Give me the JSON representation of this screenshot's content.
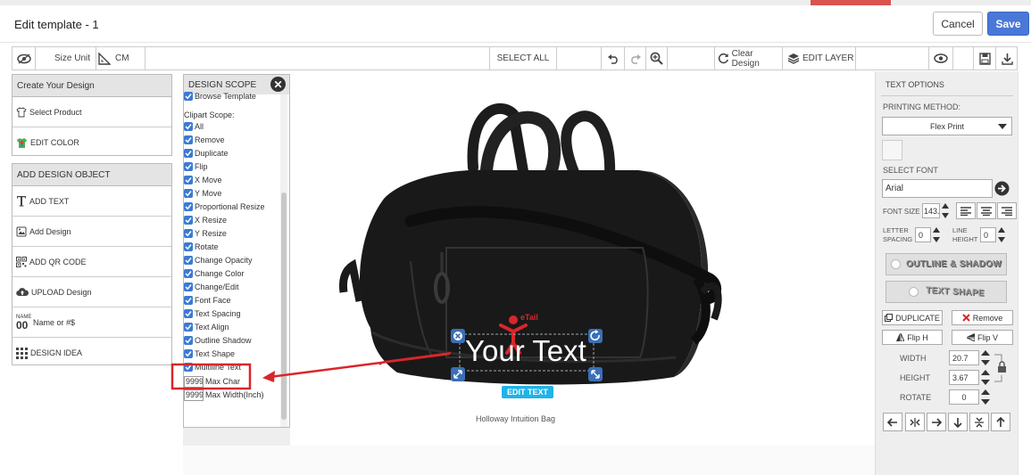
{
  "window": {
    "title": "Edit template - 1",
    "cancel_label": "Cancel",
    "save_label": "Save"
  },
  "toolbar": {
    "size_unit_label": "Size Unit",
    "unit_value": "CM",
    "select_all": "SELECT ALL",
    "clear_design": "Clear Design",
    "edit_layer": "EDIT LAYER"
  },
  "left_panel": {
    "create_header": "Create Your Design",
    "create_items": [
      "Select Product",
      "EDIT COLOR"
    ],
    "add_header": "ADD DESIGN OBJECT",
    "add_items": [
      "ADD TEXT",
      "Add Design",
      "ADD QR CODE",
      "UPLOAD Design",
      "Name or #$",
      "DESIGN IDEA"
    ],
    "name_icon_text": "00",
    "name_icon_small": "NAME"
  },
  "design_scope": {
    "title": "DESIGN SCOPE",
    "browse_template": "Browse Template",
    "clipart_label": "Clipart Scope:",
    "items": [
      "All",
      "Remove",
      "Duplicate",
      "Flip",
      "X Move",
      "Y Move",
      "Proportional Resize",
      "X Resize",
      "Y Resize",
      "Rotate",
      "Change Opacity",
      "Change Color",
      "Change/Edit",
      "Font Face",
      "Text Spacing",
      "Text Align",
      "Outline Shadow",
      "Text Shape",
      "Multiline Text"
    ],
    "max_char_value": "9999",
    "max_char_label": "Max Char",
    "max_width_value": "9999",
    "max_width_label": "Max Width(Inch)"
  },
  "canvas": {
    "design_text": "Your Text",
    "logo_text": "eTail",
    "edit_text_button": "EDIT TEXT",
    "product_name": "Holloway Intuition Bag"
  },
  "right_panel": {
    "text_options": "TEXT OPTIONS",
    "printing_method_label": "PRINTING METHOD:",
    "printing_method_value": "Flex Print",
    "select_font_label": "SELECT FONT",
    "font_value": "Arial",
    "font_size_label": "FONT SIZE",
    "font_size_value": "143.",
    "letter_spacing_label_1": "LETTER",
    "letter_spacing_label_2": "SPACING",
    "letter_spacing_value": "0",
    "line_height_label_1": "LINE",
    "line_height_label_2": "HEIGHT",
    "line_height_value": "0",
    "outline_shadow": "OUTLINE & SHADOW",
    "text_shape": "TEXT SHAPE",
    "duplicate": "DUPLICATE",
    "remove": "Remove",
    "flip_h": "Flip H",
    "flip_v": "Flip V",
    "width_label": "WIDTH",
    "width_value": "20.7",
    "height_label": "HEIGHT",
    "height_value": "3.67",
    "rotate_label": "ROTATE",
    "rotate_value": "0"
  },
  "colors": {
    "accent": "#4a78d8",
    "highlight": "#d9262b",
    "edit_text_bg": "#1fb3e8",
    "handle": "#3b6fb6"
  }
}
